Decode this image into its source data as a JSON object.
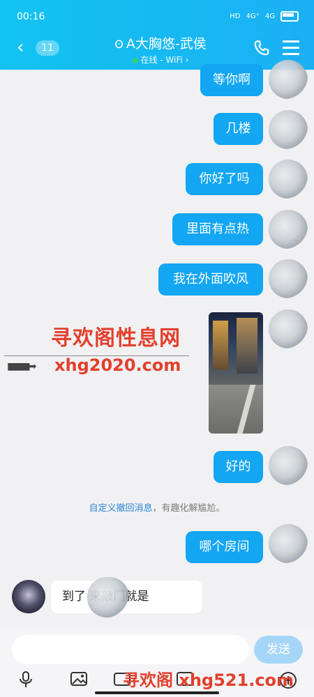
{
  "status_bar": {
    "time": "00:16",
    "hd": "HD",
    "net1": "4G⁺",
    "net2": "4G"
  },
  "header": {
    "back_icon": "chevron-left-icon",
    "unread_count": "11",
    "contact_name": "A大胸悠-武侯",
    "status_text": "在线 - WiFi",
    "status_chevron": "›",
    "accent_color": "#12a6f3"
  },
  "messages": [
    {
      "text": "等你啊"
    },
    {
      "text": "几楼"
    },
    {
      "text": "你好了吗"
    },
    {
      "text": "里面有点热"
    },
    {
      "text": "我在外面吹风"
    },
    {
      "text": "好的"
    },
    {
      "text": "哪个房间"
    }
  ],
  "watermark": {
    "title": "寻欢阁性息网",
    "url": "xhg2020.com",
    "arrows": "■■■➡",
    "bottom": "寻欢阁 xhg521.com"
  },
  "notice": {
    "link_text": "自定义撤回消息",
    "rest_text": "，有趣化解尴尬。"
  },
  "incoming": {
    "text": "到了        来敲门就是"
  },
  "composer": {
    "placeholder": "",
    "send_label": "发送"
  },
  "toolbar": {
    "icons": [
      "mic-icon",
      "image-icon",
      "camera-icon",
      "emoji-icon",
      "add-icon"
    ]
  }
}
